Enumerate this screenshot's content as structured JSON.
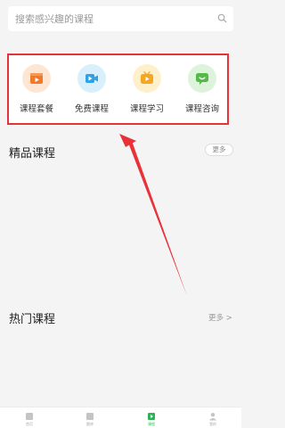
{
  "search": {
    "placeholder": "搜索感兴趣的课程",
    "icon": "search-icon"
  },
  "categories": [
    {
      "label": "课程套餐",
      "icon": "course-package-icon",
      "bg": "#fde6d3",
      "fg": "#f07a2a"
    },
    {
      "label": "免费课程",
      "icon": "free-video-icon",
      "bg": "#d9effb",
      "fg": "#2ea2e5"
    },
    {
      "label": "课程学习",
      "icon": "course-study-icon",
      "bg": "#fff0cc",
      "fg": "#f5a623"
    },
    {
      "label": "课程咨询",
      "icon": "consult-chat-icon",
      "bg": "#def3dc",
      "fg": "#54b948"
    }
  ],
  "sections": {
    "featured": {
      "title": "精品课程",
      "more_label": "更多"
    },
    "hot": {
      "title": "热门课程",
      "more_label": "更多 >"
    }
  },
  "bottom_nav": [
    {
      "label": "首页",
      "icon": "home-icon",
      "active": false
    },
    {
      "label": "题库",
      "icon": "question-bank-icon",
      "active": false
    },
    {
      "label": "课程",
      "icon": "course-play-icon",
      "active": true
    },
    {
      "label": "我的",
      "icon": "profile-icon",
      "active": false
    }
  ],
  "colors": {
    "highlight_border": "#e8323a",
    "arrow": "#e8323a",
    "nav_active": "#2fb355"
  }
}
